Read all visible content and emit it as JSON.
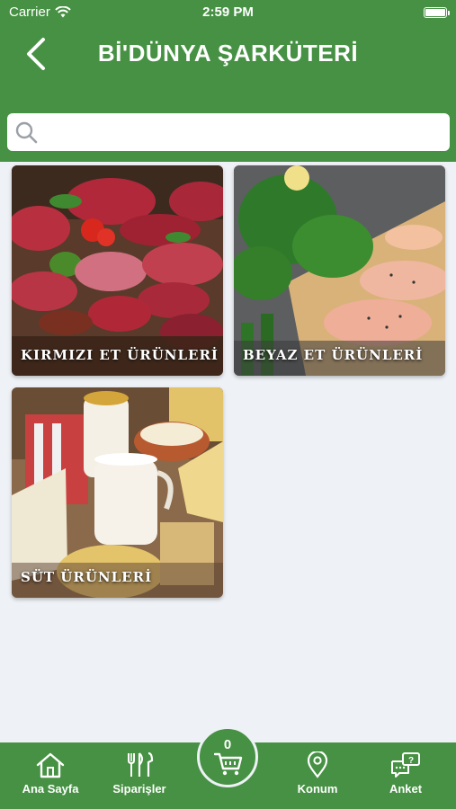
{
  "status_bar": {
    "carrier": "Carrier",
    "time": "2:59 PM"
  },
  "header": {
    "title": "Bİ'DÜNYA ŞARKÜTERİ"
  },
  "search": {
    "placeholder": ""
  },
  "categories": [
    {
      "label": "KIRMIZI ET ÜRÜNLERİ",
      "image": "red-meat-photo"
    },
    {
      "label": "BEYAZ ET ÜRÜNLERİ",
      "image": "chicken-photo"
    },
    {
      "label": "SÜT ÜRÜNLERİ",
      "image": "dairy-photo"
    }
  ],
  "bottom_nav": {
    "home": "Ana Sayfa",
    "orders": "Siparişler",
    "cart_count": "0",
    "location": "Konum",
    "survey": "Anket"
  },
  "colors": {
    "primary": "#469143",
    "background": "#eef1f5"
  }
}
